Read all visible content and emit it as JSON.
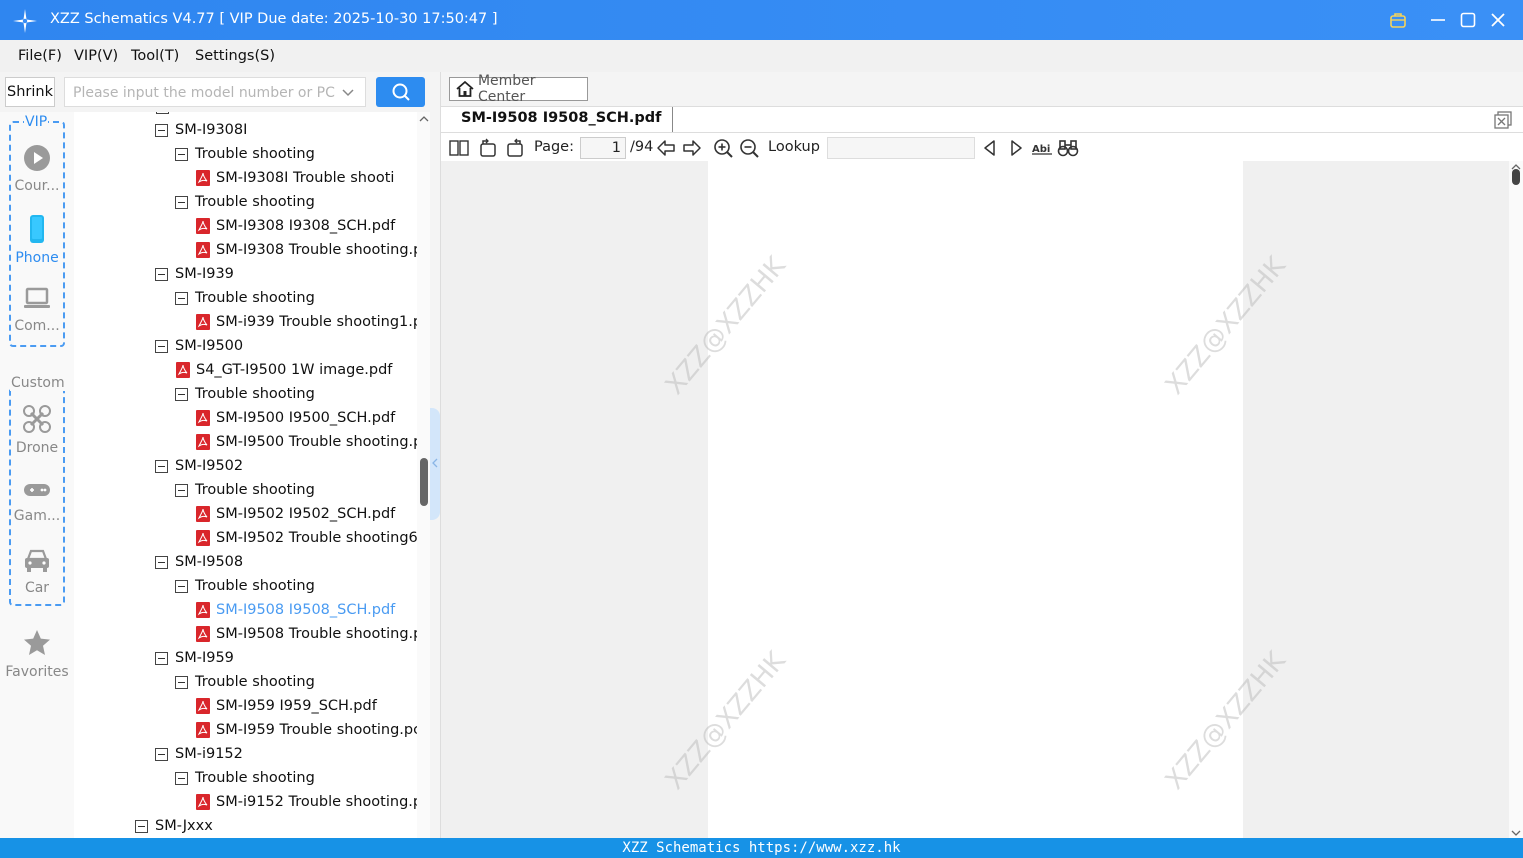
{
  "window": {
    "title": "XZZ Schematics V4.77 [ VIP Due date: 2025-10-30 17:50:47 ]"
  },
  "menu": [
    "File(F)",
    "VIP(V)",
    "Tool(T)",
    "Settings(S)"
  ],
  "search": {
    "shrink_label": "Shrink",
    "placeholder": "Please input the model number or PCB"
  },
  "categories": {
    "vip_title": "VIP",
    "custom_title": "Custom",
    "items": [
      {
        "label": "Cour...",
        "icon": "play-circle-icon"
      },
      {
        "label": "Phone",
        "icon": "phone-icon"
      },
      {
        "label": "Com...",
        "icon": "laptop-icon"
      },
      {
        "label": "Drone",
        "icon": "drone-icon"
      },
      {
        "label": "Gam...",
        "icon": "gamepad-icon"
      },
      {
        "label": "Car",
        "icon": "car-icon"
      }
    ],
    "favorites_label": "Favorites"
  },
  "tree": [
    {
      "text": "SM-I9308I",
      "type": "node"
    },
    {
      "text": "Trouble shooting",
      "type": "node"
    },
    {
      "text": "SM-I9308I Trouble shooti",
      "type": "pdf"
    },
    {
      "text": "Trouble shooting",
      "type": "node"
    },
    {
      "text": "SM-I9308 I9308_SCH.pdf",
      "type": "pdf"
    },
    {
      "text": "SM-I9308 Trouble shooting.p",
      "type": "pdf"
    },
    {
      "text": "SM-I939",
      "type": "node"
    },
    {
      "text": "Trouble shooting",
      "type": "node"
    },
    {
      "text": "SM-i939 Trouble shooting1.p",
      "type": "pdf"
    },
    {
      "text": "SM-I9500",
      "type": "node"
    },
    {
      "text": "S4_GT-I9500 1W image.pdf",
      "type": "pdf"
    },
    {
      "text": "Trouble shooting",
      "type": "node"
    },
    {
      "text": "SM-I9500 I9500_SCH.pdf",
      "type": "pdf"
    },
    {
      "text": "SM-I9500 Trouble shooting.p",
      "type": "pdf"
    },
    {
      "text": "SM-I9502",
      "type": "node"
    },
    {
      "text": "Trouble shooting",
      "type": "node"
    },
    {
      "text": "SM-I9502 I9502_SCH.pdf",
      "type": "pdf"
    },
    {
      "text": "SM-I9502 Trouble shooting6",
      "type": "pdf"
    },
    {
      "text": "SM-I9508",
      "type": "node"
    },
    {
      "text": "Trouble shooting",
      "type": "node"
    },
    {
      "text": "SM-I9508 I9508_SCH.pdf",
      "type": "pdf",
      "selected": true
    },
    {
      "text": "SM-I9508 Trouble shooting.p",
      "type": "pdf"
    },
    {
      "text": "SM-I959",
      "type": "node"
    },
    {
      "text": "Trouble shooting",
      "type": "node"
    },
    {
      "text": "SM-I959  I959_SCH.pdf",
      "type": "pdf"
    },
    {
      "text": "SM-I959 Trouble shooting.pc",
      "type": "pdf"
    },
    {
      "text": "SM-i9152",
      "type": "node"
    },
    {
      "text": "Trouble shooting",
      "type": "node"
    },
    {
      "text": "SM-i9152 Trouble shooting.p",
      "type": "pdf"
    },
    {
      "text": "SM-Jxxx",
      "type": "node"
    }
  ],
  "viewer": {
    "member_center": "Member Center",
    "tab_title": "SM-I9508 I9508_SCH.pdf",
    "page_label": "Page:",
    "page_current": "1",
    "page_total": "/94",
    "lookup_label": "Lookup",
    "watermark": "XZZ@XZZHK"
  },
  "status": {
    "text": "XZZ Schematics https://www.xzz.hk"
  },
  "colors": {
    "accent": "#2d8cf0",
    "titlebar": "#3a8ef5",
    "statusbar": "#1792e6",
    "pdf": "#d9262b",
    "selected": "#4a9bf2"
  }
}
